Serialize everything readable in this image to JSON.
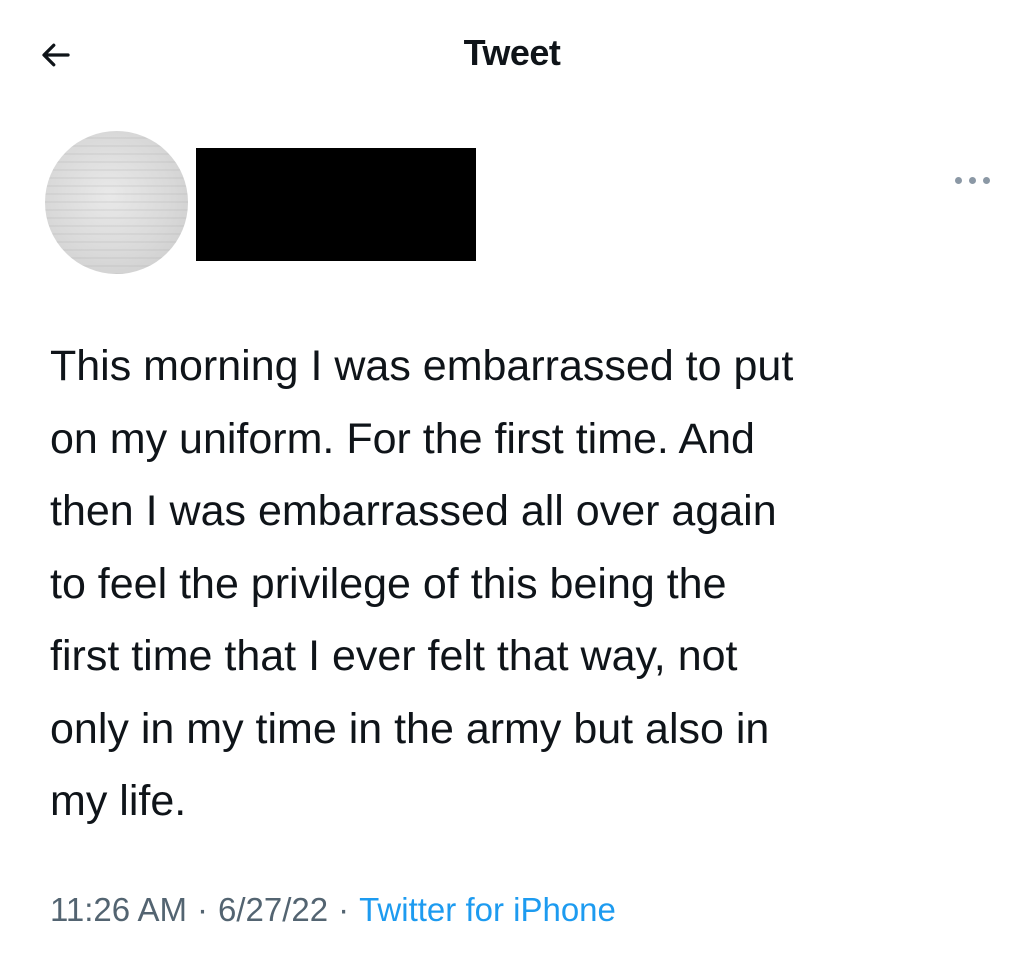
{
  "header": {
    "title": "Tweet",
    "back_icon": "arrow-left-icon"
  },
  "author": {
    "avatar_icon": "avatar",
    "name_redacted": true
  },
  "more_icon": "more-horizontal-icon",
  "tweet": {
    "text": "This morning I was embarrassed to put\non my uniform. For the first time. And\nthen I was embarrassed all over again\nto feel the privilege of this being the\nfirst time that I ever felt that way, not\nonly in my time in the army but also in\nmy life.",
    "time": "11:26 AM",
    "date": "6/27/22",
    "separator": "·",
    "source": "Twitter for iPhone"
  },
  "colors": {
    "text_primary": "#0f1419",
    "text_secondary": "#536471",
    "link": "#1d9bf0",
    "redaction": "#000000"
  }
}
